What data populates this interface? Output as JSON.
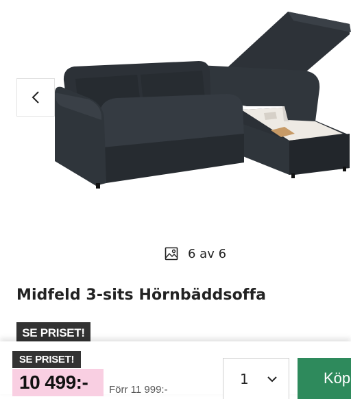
{
  "gallery": {
    "image_alt": "Midfeld 3-sits Hörnbäddsoffa",
    "counter": "6 av 6"
  },
  "product": {
    "title": "Midfeld 3-sits Hörnbäddsoffa",
    "badge": "SE PRISET!"
  },
  "sticky_bar": {
    "badge": "SE PRISET!",
    "price": "10 499:-",
    "old_price": "Förr 11 999:-",
    "quantity": "1",
    "buy_label": "Köp"
  },
  "colors": {
    "price_highlight": "#f9cfe2",
    "badge_bg": "#333333",
    "buy_button": "#2e8a5c",
    "sofa": "#2a2f35"
  },
  "icons": {
    "prev": "chevron-left-icon",
    "gallery": "image-icon",
    "quantity": "chevron-down-icon"
  }
}
